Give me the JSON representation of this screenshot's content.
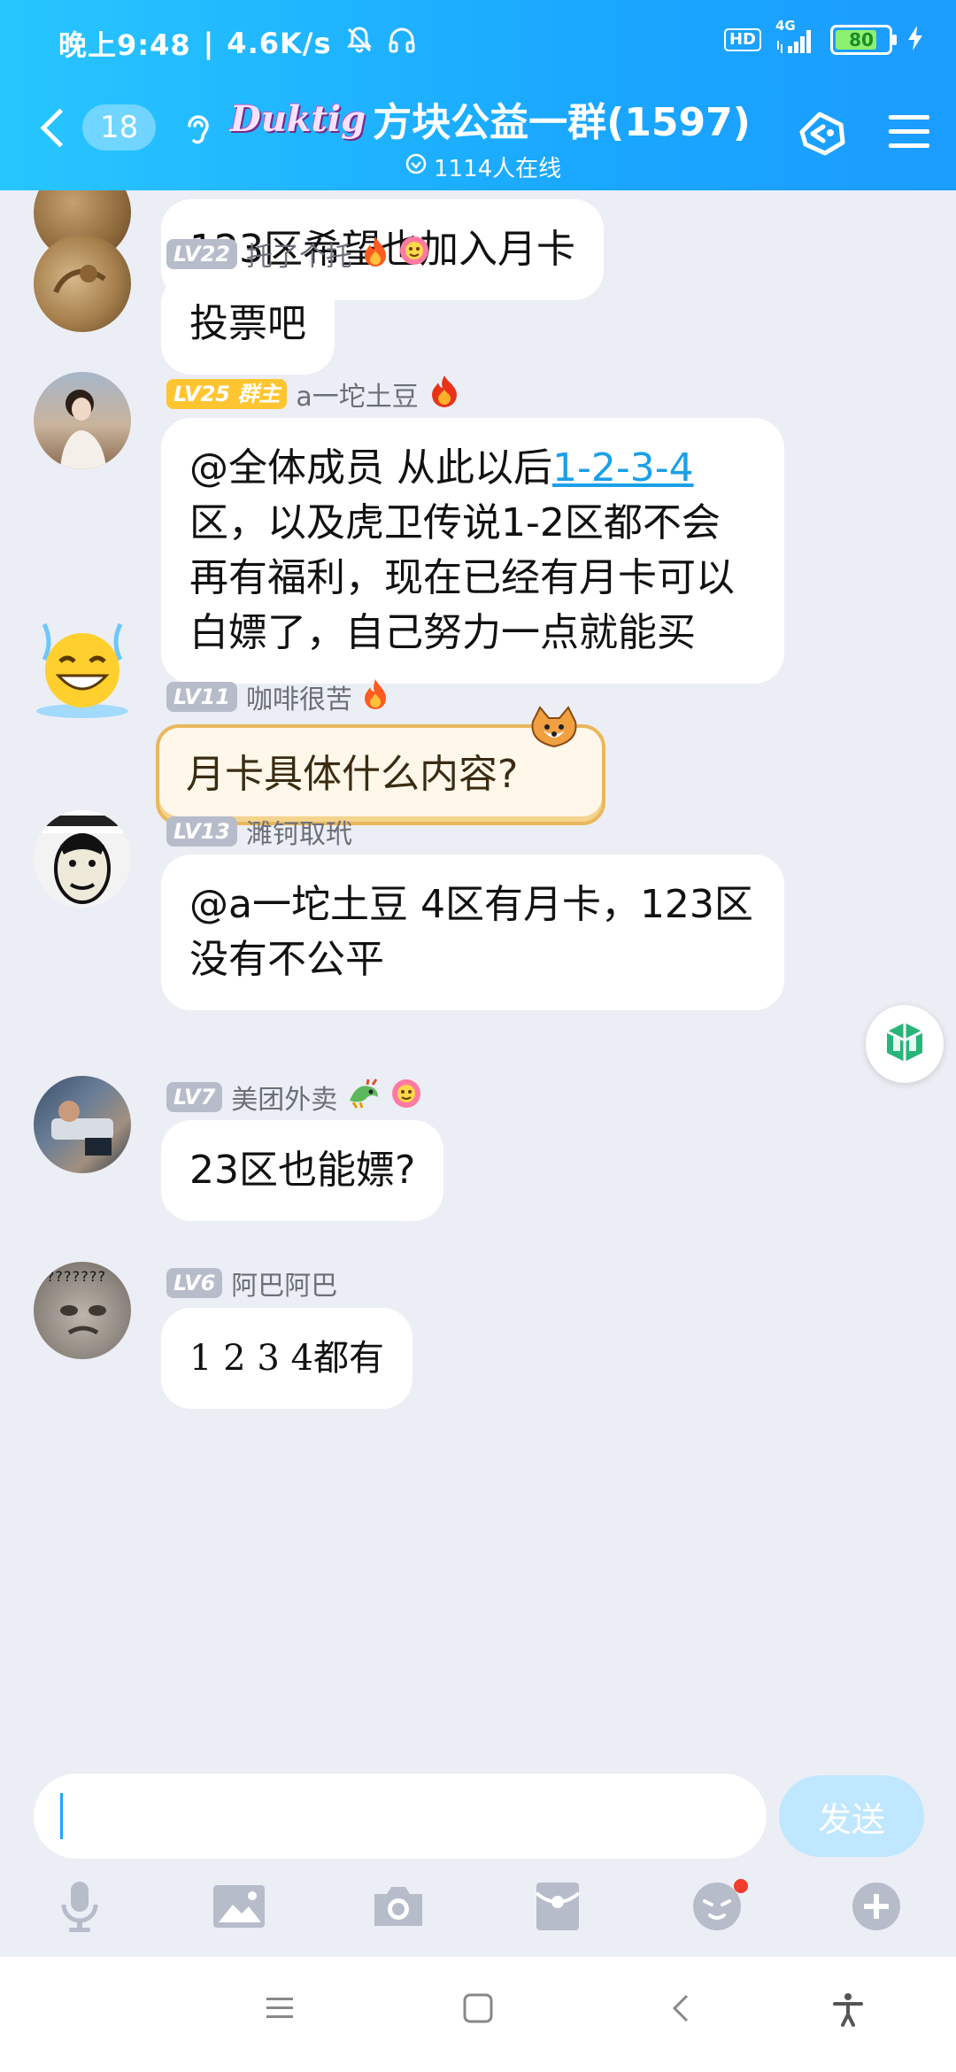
{
  "status_bar": {
    "time": "晚上9:48",
    "speed": "4.6K/s",
    "network": "4G",
    "hd": "HD",
    "battery": "80"
  },
  "header": {
    "unread_count": "18",
    "group_logo": "Duktig",
    "group_name": "方块公益一群(1597)",
    "online_text": "1114人在线"
  },
  "messages": [
    {
      "level": "",
      "name": "",
      "text": "123区希望也加入月卡"
    },
    {
      "level": "LV22",
      "name": "托了个托",
      "text": "投票吧"
    },
    {
      "level": "LV25",
      "role": "群主",
      "name": "a一坨土豆",
      "text_prefix": "@全体成员 从此以后",
      "link": "1-2-3-4",
      "text_suffix": "区，以及虎卫传说1-2区都不会再有福利，现在已经有月卡可以白嫖了，自己努力一点就能买"
    },
    {
      "level": "LV11",
      "name": "咖啡很苦",
      "text": "月卡具体什么内容?"
    },
    {
      "level": "LV13",
      "name": "濉钶取玳",
      "text": "@a一坨土豆 4区有月卡，123区没有不公平"
    },
    {
      "level": "LV7",
      "name": "美团外卖",
      "text": "23区也能嫖?"
    },
    {
      "level": "LV6",
      "name": "阿巴阿巴",
      "text": "1 2 3 4都有",
      "avatar_caption": "???????"
    }
  ],
  "input": {
    "placeholder": "",
    "send_label": "发送"
  },
  "colors": {
    "header_gradient_start": "#27c6ff",
    "header_gradient_end": "#1b9cff",
    "chat_background": "#eceef5",
    "link": "#1aa0e8",
    "owner_badge": "#ffc531"
  }
}
